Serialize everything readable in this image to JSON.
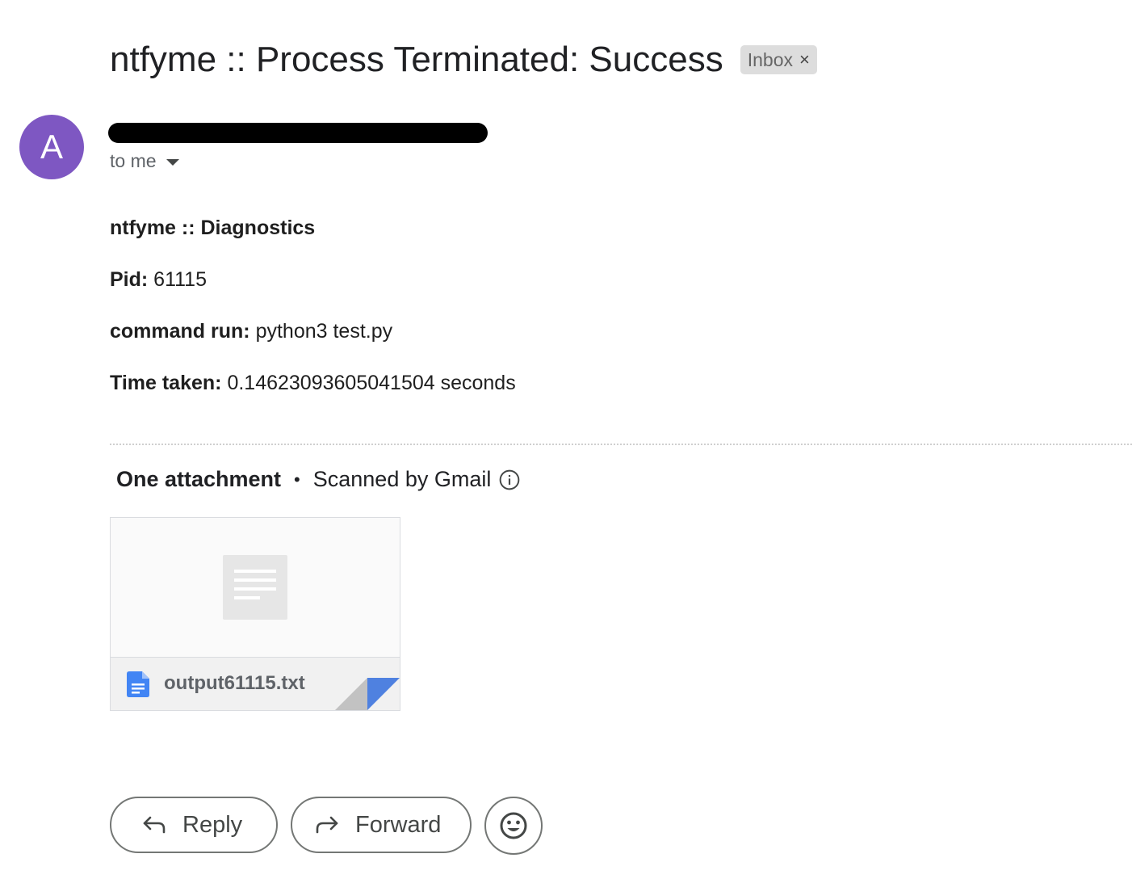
{
  "email": {
    "subject": "ntfyme :: Process Terminated: Success",
    "label_chip": "Inbox",
    "label_remove": "×",
    "avatar_letter": "A",
    "recipient_text": "to me"
  },
  "body": {
    "heading": "ntfyme :: Diagnostics",
    "pid_label": "Pid:",
    "pid_value": "61115",
    "command_label": "command run:",
    "command_value": "python3 test.py",
    "time_label": "Time taken:",
    "time_value": "0.14623093605041504 seconds"
  },
  "attachments": {
    "count_text": "One attachment",
    "separator": "•",
    "scan_text": "Scanned by Gmail",
    "files": [
      {
        "name": "output61115.txt",
        "icon": "google-docs-icon"
      }
    ]
  },
  "actions": {
    "reply_label": "Reply",
    "forward_label": "Forward",
    "emoji_icon": "smiley-icon"
  },
  "colors": {
    "avatar": "#7e57c2",
    "doc_icon": "#4285f4",
    "chip_bg": "#dddddd"
  }
}
